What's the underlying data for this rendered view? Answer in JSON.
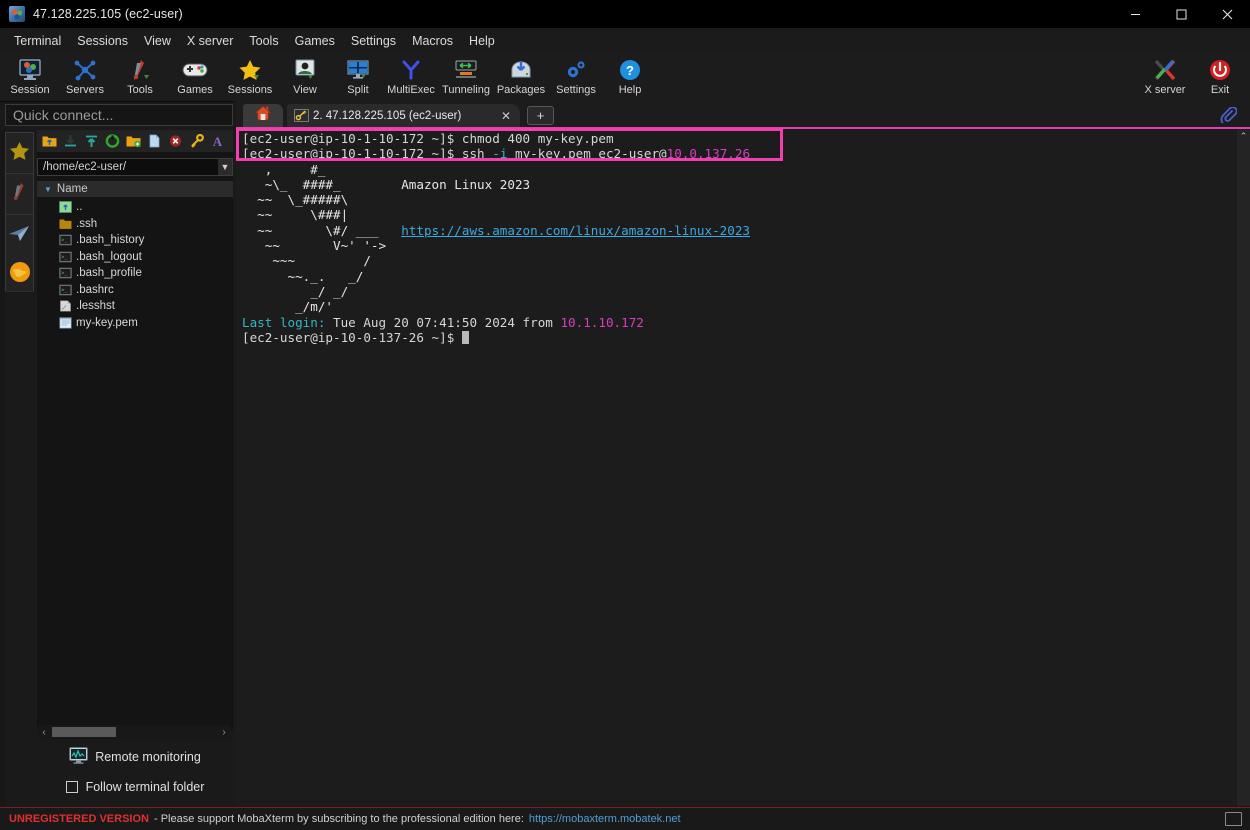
{
  "window": {
    "title": "47.128.225.105 (ec2-user)",
    "icon": "mobaxterm-icon",
    "controls": {
      "minimize": "–",
      "maximize": "☐",
      "close": "✕"
    }
  },
  "menubar": {
    "items": [
      {
        "label": "Terminal"
      },
      {
        "label": "Sessions"
      },
      {
        "label": "View"
      },
      {
        "label": "X server"
      },
      {
        "label": "Tools"
      },
      {
        "label": "Games"
      },
      {
        "label": "Settings"
      },
      {
        "label": "Macros"
      },
      {
        "label": "Help"
      }
    ]
  },
  "toolbar": {
    "buttons": [
      {
        "label": "Session",
        "icon": "session-icon"
      },
      {
        "label": "Servers",
        "icon": "servers-icon"
      },
      {
        "label": "Tools",
        "icon": "tools-icon"
      },
      {
        "label": "Games",
        "icon": "games-icon"
      },
      {
        "label": "Sessions",
        "icon": "sessions-star-icon"
      },
      {
        "label": "View",
        "icon": "view-icon"
      },
      {
        "label": "Split",
        "icon": "split-icon"
      },
      {
        "label": "MultiExec",
        "icon": "multiexec-icon"
      },
      {
        "label": "Tunneling",
        "icon": "tunneling-icon"
      },
      {
        "label": "Packages",
        "icon": "packages-icon"
      },
      {
        "label": "Settings",
        "icon": "settings-gear-icon"
      },
      {
        "label": "Help",
        "icon": "help-icon"
      }
    ],
    "right_buttons": [
      {
        "label": "X server",
        "icon": "xserver-icon"
      },
      {
        "label": "Exit",
        "icon": "exit-power-icon"
      }
    ]
  },
  "quick_connect": {
    "placeholder": "Quick connect..."
  },
  "rail": {
    "items": [
      {
        "name": "sessions-star-icon"
      },
      {
        "name": "tools-knife-icon"
      },
      {
        "name": "sftp-plane-icon"
      }
    ],
    "globe": {
      "name": "macros-globe-icon"
    }
  },
  "file_browser": {
    "toolbar_icons": [
      "parent-folder-icon",
      "download-icon",
      "upload-icon",
      "refresh-icon",
      "new-folder-icon",
      "new-file-icon",
      "delete-icon",
      "permissions-key-icon",
      "text-edit-icon"
    ],
    "path": "/home/ec2-user/",
    "path_dropdown": "▼",
    "column_header": "Name",
    "sort_arrow": "▼",
    "files": [
      {
        "name": "..",
        "icon": "parent-folder-icon"
      },
      {
        "name": ".ssh",
        "icon": "folder-icon"
      },
      {
        "name": ".bash_history",
        "icon": "script-file-icon"
      },
      {
        "name": ".bash_logout",
        "icon": "script-file-icon"
      },
      {
        "name": ".bash_profile",
        "icon": "script-file-icon"
      },
      {
        "name": ".bashrc",
        "icon": "script-file-icon"
      },
      {
        "name": ".lesshst",
        "icon": "generic-file-icon"
      },
      {
        "name": "my-key.pem",
        "icon": "pem-file-icon"
      }
    ],
    "hscroll": {
      "left": "‹",
      "right": "›"
    },
    "remote_monitoring": "Remote monitoring",
    "follow_terminal_folder": "Follow terminal folder"
  },
  "tabs": {
    "home_icon": "home-icon",
    "session_tab": {
      "label": "2. 47.128.225.105 (ec2-user)",
      "icon": "ssh-key-icon",
      "close": "✕"
    },
    "new_tab": "+",
    "clipboard_icon": "paperclip-icon"
  },
  "terminal": {
    "lines": [
      {
        "segments": [
          {
            "t": "[ec2-user@ip-10-1-10-172 ~]$ chmod 400 my-key.pem",
            "c": "c-br"
          }
        ]
      },
      {
        "segments": [
          {
            "t": "[ec2-user@ip-10-1-10-172 ~]$ ",
            "c": "c-br"
          },
          {
            "t": "ssh ",
            "c": "c-br"
          },
          {
            "t": "-i",
            "c": "c-cyan"
          },
          {
            "t": " my-key.pem ec2-user@",
            "c": "c-br"
          },
          {
            "t": "10.0.137.26",
            "c": "c-mag"
          }
        ]
      },
      {
        "segments": [
          {
            "t": "   ,     #_",
            "c": "c-art"
          }
        ]
      },
      {
        "segments": [
          {
            "t": "   ~\\_  ####_        Amazon Linux 2023",
            "c": "c-art"
          }
        ]
      },
      {
        "segments": [
          {
            "t": "  ~~  \\_#####\\",
            "c": "c-art"
          }
        ]
      },
      {
        "segments": [
          {
            "t": "  ~~     \\###|",
            "c": "c-art"
          }
        ]
      },
      {
        "segments": [
          {
            "t": "  ~~       \\#/ ___   ",
            "c": "c-art"
          },
          {
            "t": "https://aws.amazon.com/linux/amazon-linux-2023",
            "c": "c-link"
          }
        ]
      },
      {
        "segments": [
          {
            "t": "   ~~       V~' '->",
            "c": "c-art"
          }
        ]
      },
      {
        "segments": [
          {
            "t": "    ~~~         /",
            "c": "c-art"
          }
        ]
      },
      {
        "segments": [
          {
            "t": "      ~~._.   _/",
            "c": "c-art"
          }
        ]
      },
      {
        "segments": [
          {
            "t": "         _/ _/",
            "c": "c-art"
          }
        ]
      },
      {
        "segments": [
          {
            "t": "       _/m/'",
            "c": "c-art"
          }
        ]
      },
      {
        "segments": [
          {
            "t": "Last login:",
            "c": "c-cyan"
          },
          {
            "t": " Tue Aug 20 07:41:50 2024 from ",
            "c": "c-br"
          },
          {
            "t": "10.1.10.172",
            "c": "c-mag"
          }
        ]
      },
      {
        "segments": [
          {
            "t": "[ec2-user@ip-10-0-137-26 ~]$ ",
            "c": "c-br"
          },
          {
            "t": "",
            "c": "cursor"
          }
        ]
      }
    ],
    "highlight_color": "#f23fb0",
    "scroll_up_arrow": "⌃"
  },
  "status_bar": {
    "unregistered": "UNREGISTERED VERSION",
    "message": "-  Please support MobaXterm by subscribing to the professional edition here:",
    "url": "https://mobaxterm.mobatek.net"
  },
  "colors": {
    "accent_magenta": "#e040b0",
    "link_blue": "#3ea8e0",
    "terminal_bg": "#1c1c1c",
    "cyan": "#2fb8c4"
  }
}
